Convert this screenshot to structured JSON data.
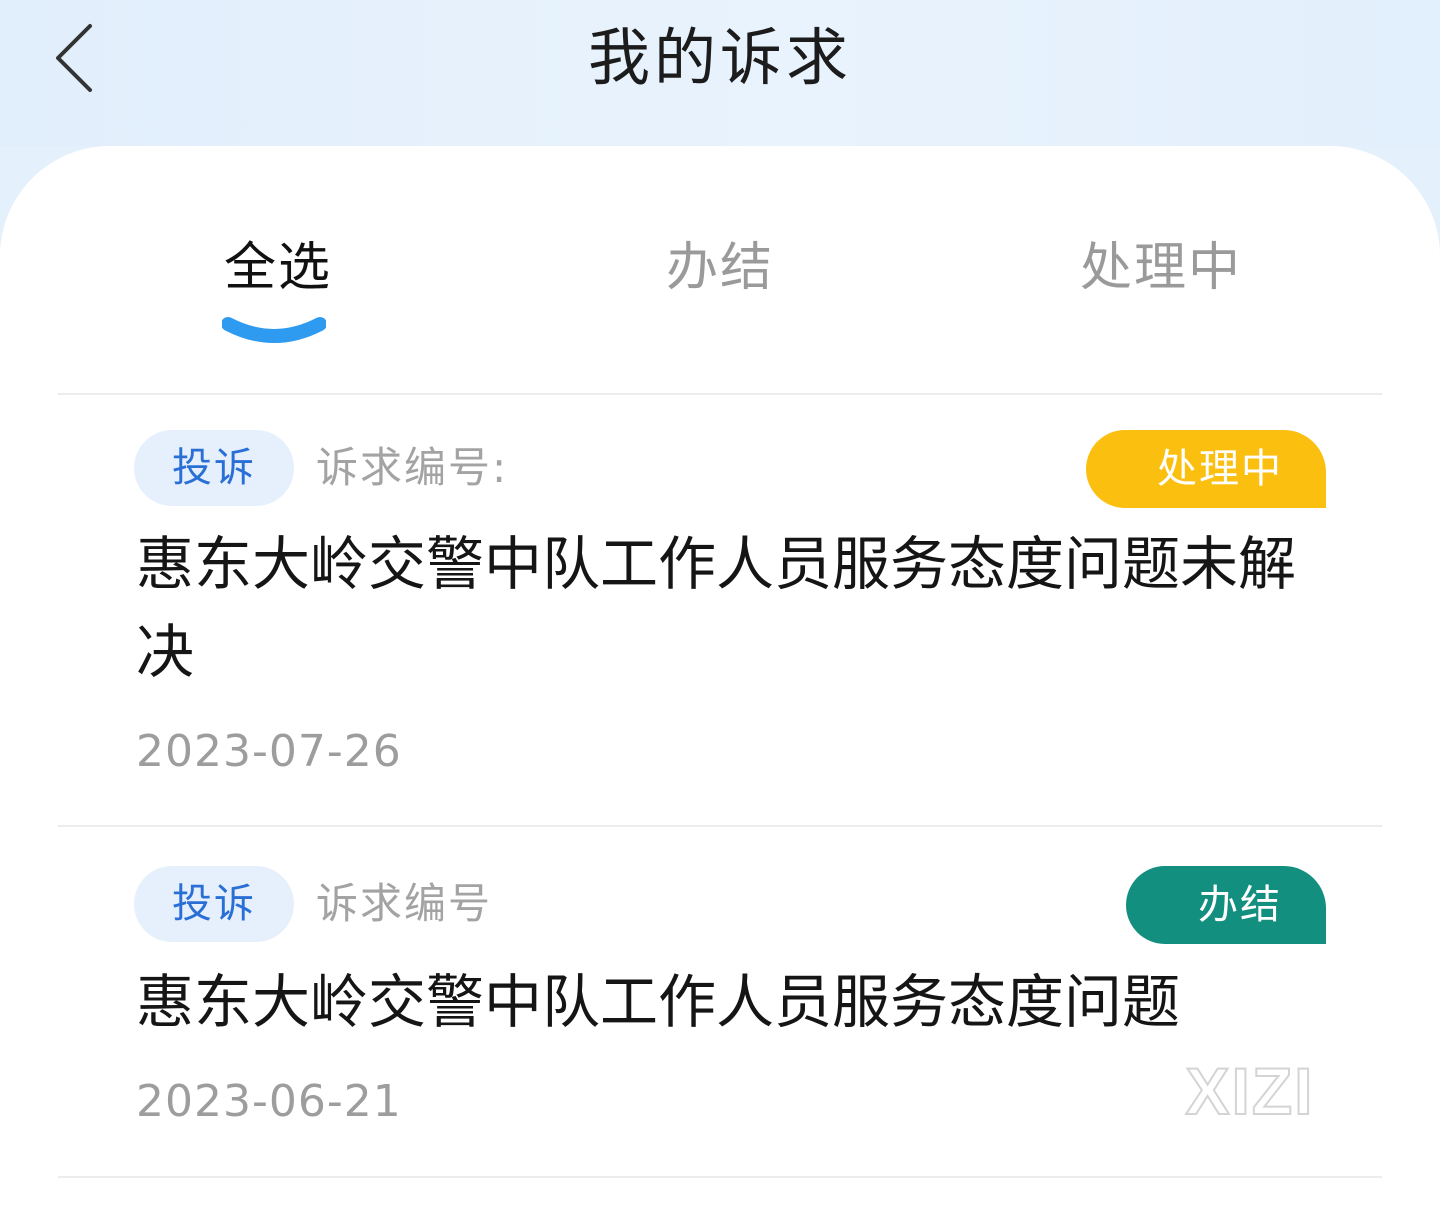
{
  "header": {
    "title": "我的诉求"
  },
  "tabs": [
    {
      "label": "全选",
      "active": true
    },
    {
      "label": "办结",
      "active": false
    },
    {
      "label": "处理中",
      "active": false
    }
  ],
  "items": [
    {
      "type": "投诉",
      "code_label": "诉求编号:",
      "status": "处理中",
      "status_color": "#fbbf10",
      "title": "惠东大岭交警中队工作人员服务态度问题未解决",
      "date": "2023-07-26"
    },
    {
      "type": "投诉",
      "code_label": "诉求编号",
      "status": "办结",
      "status_color": "#138f80",
      "title": "惠东大岭交警中队工作人员服务态度问题",
      "date": "2023-06-21"
    }
  ],
  "colors": {
    "accent": "#2f9bf0",
    "type_badge_text": "#2a6fd6",
    "type_badge_bg": "#e6f0fc"
  },
  "watermark": "XIZI"
}
